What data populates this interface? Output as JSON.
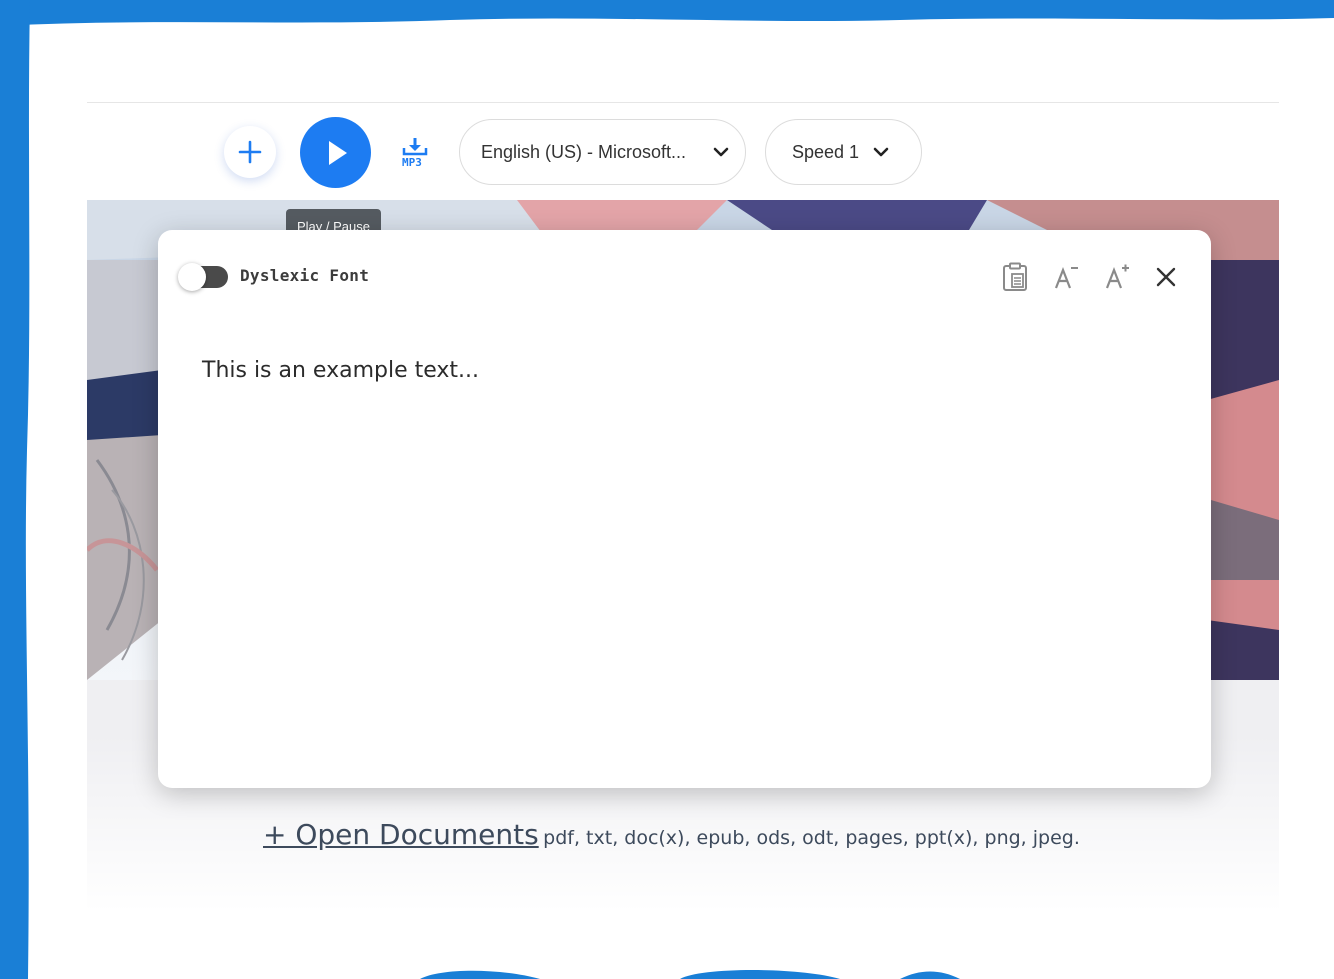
{
  "toolbar": {
    "add_icon": "plus-icon",
    "play_icon": "play-icon",
    "mp3_icon": "download-mp3-icon",
    "mp3_label": "MP3",
    "voice_select": "English (US) - Microsoft...",
    "speed_select": "Speed 1",
    "accent_color": "#1d7cf2"
  },
  "tooltip": {
    "text": "Play / Pause"
  },
  "editor": {
    "dyslexic_toggle_label": "Dyslexic Font",
    "dyslexic_toggle_on": false,
    "content": "This is an example text...",
    "icons": [
      "clipboard-icon",
      "font-decrease-icon",
      "font-increase-icon",
      "close-icon"
    ]
  },
  "footer": {
    "open_documents_label": "+ Open Documents",
    "formats": "pdf, txt, doc(x), epub, ods, odt, pages, ppt(x), png, jpeg."
  },
  "frame_color": "#1a7fd6"
}
